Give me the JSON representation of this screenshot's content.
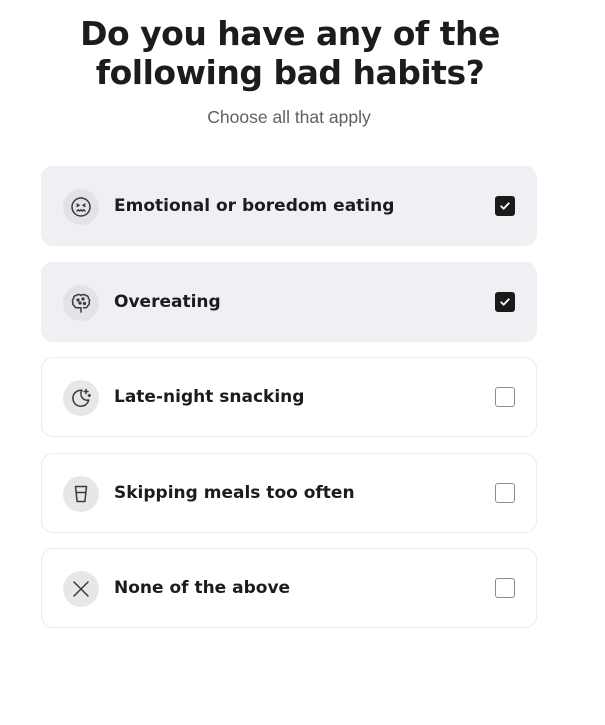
{
  "question": {
    "title_line1": "Do you have any of the",
    "title_line2": "following bad habits?",
    "subtitle": "Choose all that apply"
  },
  "options": [
    {
      "label": "Emotional or boredom eating",
      "icon": "sad-face-icon",
      "checked": true
    },
    {
      "label": "Overeating",
      "icon": "brain-icon",
      "checked": true
    },
    {
      "label": "Late-night snacking",
      "icon": "moon-icon",
      "checked": false
    },
    {
      "label": "Skipping meals too often",
      "icon": "cup-icon",
      "checked": false
    },
    {
      "label": "None of the above",
      "icon": "close-icon",
      "checked": false
    }
  ],
  "colors": {
    "selected_background": "#eff0f4",
    "checkbox_checked": "#1a1a1a",
    "text": "#1c1c1e",
    "subtitle": "#5f5f64"
  }
}
